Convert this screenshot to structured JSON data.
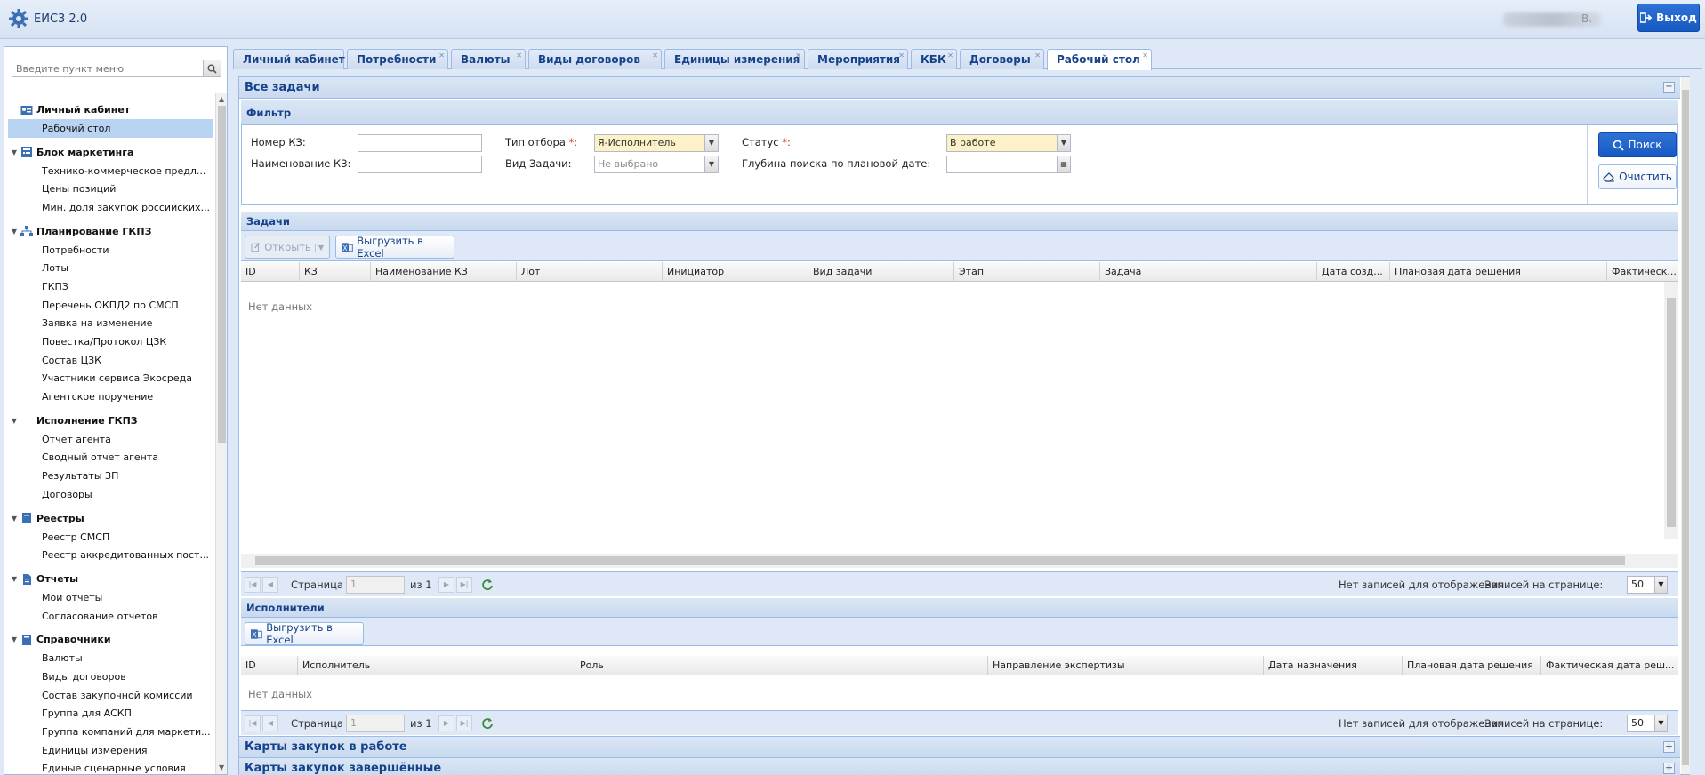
{
  "app": {
    "title": "ЕИС3 2.0",
    "user_suffix": "В.",
    "exit_label": "Выход"
  },
  "sidebar": {
    "search_placeholder": "Введите пункт меню",
    "groups": [
      {
        "label": "Личный кабинет",
        "items": [
          "Рабочий стол"
        ]
      },
      {
        "label": "Блок маркетинга",
        "items": [
          "Технико-коммерческое предл...",
          "Цены позиций",
          "Мин. доля закупок российских..."
        ]
      },
      {
        "label": "Планирование ГКПЗ",
        "items": [
          "Потребности",
          "Лоты",
          "ГКПЗ",
          "Перечень ОКПД2 по СМСП",
          "Заявка на изменение",
          "Повестка/Протокол ЦЗК",
          "Состав ЦЗК",
          "Участники сервиса Экосреда",
          "Агентское поручение"
        ]
      },
      {
        "label": "Исполнение ГКПЗ",
        "items": [
          "Отчет агента",
          "Сводный отчет агента",
          "Результаты ЗП",
          "Договоры"
        ]
      },
      {
        "label": "Реестры",
        "items": [
          "Реестр СМСП",
          "Реестр аккредитованных пост..."
        ]
      },
      {
        "label": "Отчеты",
        "items": [
          "Мои отчеты",
          "Согласование отчетов"
        ]
      },
      {
        "label": "Справочники",
        "items": [
          "Валюты",
          "Виды договоров",
          "Состав закупочной комиссии",
          "Группа для АСКП",
          "Группа компаний для маркети...",
          "Единицы измерения",
          "Единые сценарные условия"
        ]
      }
    ],
    "selected": "Рабочий стол"
  },
  "tabs": [
    "Личный кабинет",
    "Потребности",
    "Валюты",
    "Виды договоров",
    "Единицы измерения",
    "Мероприятия",
    "КБК",
    "Договоры",
    "Рабочий стол"
  ],
  "active_tab": "Рабочий стол",
  "panel": {
    "title": "Все задачи",
    "filter": {
      "title": "Фильтр",
      "kz_number_label": "Номер КЗ:",
      "kz_name_label": "Наименование КЗ:",
      "selection_type_label": "Тип отбора",
      "selection_type_value": "Я-Исполнитель",
      "task_type_label": "Вид Задачи:",
      "task_type_value": "Не выбрано",
      "status_label": "Статус",
      "status_value": "В работе",
      "depth_label": "Глубина поиска по плановой дате:",
      "required_mark": "*:",
      "search_button": "Поиск",
      "clear_button": "Очистить"
    },
    "tasks": {
      "title": "Задачи",
      "open_button": "Открыть",
      "export_button": "Выгрузить в Excel",
      "columns": [
        "ID",
        "КЗ",
        "Наименование КЗ",
        "Лот",
        "Инициатор",
        "Вид задачи",
        "Этап",
        "Задача",
        "Дата созд...",
        "Плановая дата решения",
        "Фактическ..."
      ],
      "no_data": "Нет данных",
      "pager": {
        "page_label": "Страница",
        "page_value": "1",
        "of_label": "из 1",
        "empty_msg": "Нет записей для отображения",
        "per_page_label": "Записей на странице:",
        "per_page_value": "50"
      }
    },
    "executors": {
      "title": "Исполнители",
      "export_button": "Выгрузить в Excel",
      "columns": [
        "ID",
        "Исполнитель",
        "Роль",
        "Направление экспертизы",
        "Дата назначения",
        "Плановая дата решения",
        "Фактическая дата реш..."
      ],
      "no_data": "Нет данных",
      "pager": {
        "page_label": "Страница",
        "page_value": "1",
        "of_label": "из 1",
        "empty_msg": "Нет записей для отображения",
        "per_page_label": "Записей на странице:",
        "per_page_value": "50"
      }
    },
    "collapsed_sections": [
      "Карты закупок в работе",
      "Карты закупок завершённые"
    ]
  },
  "colors": {
    "accent": "#1659c2",
    "header_text": "#15428b",
    "selection": "#b9d3f2",
    "required_bg": "#fdf2c7"
  },
  "icons": {
    "logo": "gear-logo-icon",
    "exit": "exit-icon",
    "search": "search-icon",
    "clear": "eraser-icon",
    "excel": "excel-icon",
    "refresh": "refresh-icon"
  }
}
